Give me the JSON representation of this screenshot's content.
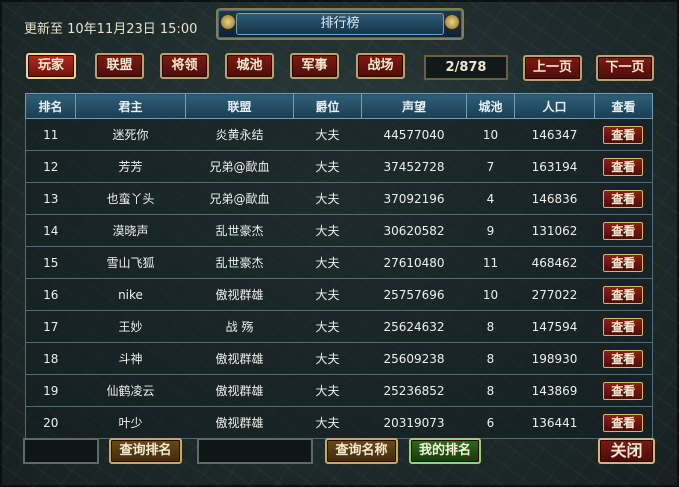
{
  "header": {
    "update_label": "更新至 10年11月23日 15:00",
    "title": "排行榜"
  },
  "tabs": [
    {
      "label": "玩家",
      "active": true
    },
    {
      "label": "联盟",
      "active": false
    },
    {
      "label": "将领",
      "active": false
    },
    {
      "label": "城池",
      "active": false
    },
    {
      "label": "军事",
      "active": false
    },
    {
      "label": "战场",
      "active": false
    }
  ],
  "pagination": {
    "page_display": "2/878",
    "prev_label": "上一页",
    "next_label": "下一页"
  },
  "table": {
    "columns": [
      "排名",
      "君主",
      "联盟",
      "爵位",
      "声望",
      "城池",
      "人口",
      "查看"
    ],
    "view_label": "查看",
    "rows": [
      [
        "11",
        "迷死你",
        "炎黄永结",
        "大夫",
        "44577040",
        "10",
        "146347"
      ],
      [
        "12",
        "芳芳",
        "兄弟@歃血",
        "大夫",
        "37452728",
        "7",
        "163194"
      ],
      [
        "13",
        "也蛮丫头",
        "兄弟@歃血",
        "大夫",
        "37092196",
        "4",
        "146836"
      ],
      [
        "14",
        "漠晓声",
        "乱世豪杰",
        "大夫",
        "30620582",
        "9",
        "131062"
      ],
      [
        "15",
        "雪山飞狐",
        "乱世豪杰",
        "大夫",
        "27610480",
        "11",
        "468462"
      ],
      [
        "16",
        "nike",
        "傲视群雄",
        "大夫",
        "25757696",
        "10",
        "277022"
      ],
      [
        "17",
        "王妙",
        "战 殇",
        "大夫",
        "25624632",
        "8",
        "147594"
      ],
      [
        "18",
        "斗神",
        "傲视群雄",
        "大夫",
        "25609238",
        "8",
        "198930"
      ],
      [
        "19",
        "仙鹤凌云",
        "傲视群雄",
        "大夫",
        "25236852",
        "8",
        "143869"
      ],
      [
        "20",
        "叶少",
        "傲视群雄",
        "大夫",
        "20319073",
        "6",
        "136441"
      ]
    ]
  },
  "footer": {
    "rank_query_label": "查询排名",
    "name_query_label": "查询名称",
    "my_rank_label": "我的排名",
    "close_label": "关闭"
  }
}
